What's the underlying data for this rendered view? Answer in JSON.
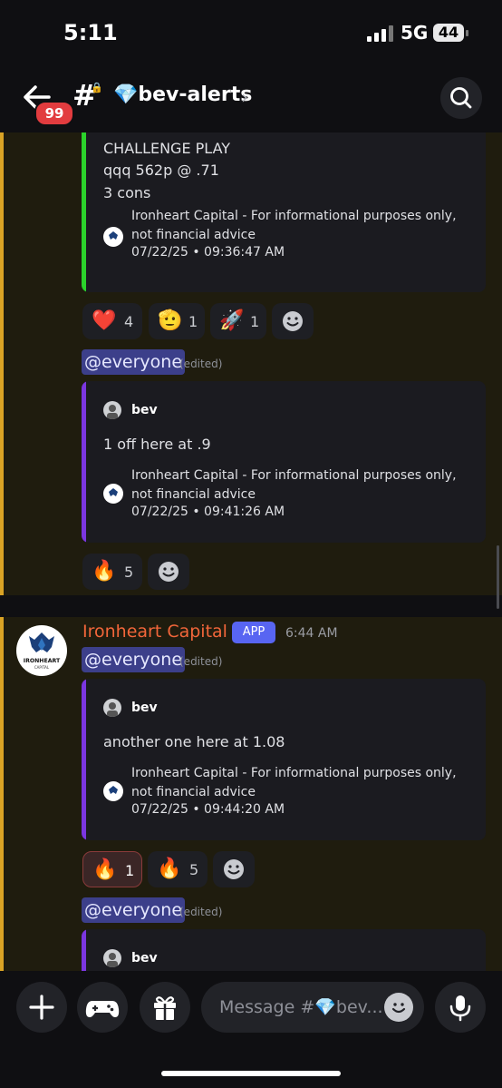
{
  "status": {
    "time": "5:11",
    "network": "5G",
    "battery": "44"
  },
  "header": {
    "unread_badge": "99",
    "hash_symbol": "#",
    "channel_name": "💎bev-alerts",
    "chevron": "›"
  },
  "messages": [
    {
      "embed": {
        "lines": [
          "CHALLENGE PLAY",
          "qqq 562p @ .71",
          "3 cons"
        ],
        "footer_text": "Ironheart Capital - For informational purposes only, not financial advice",
        "footer_date": "07/22/25  •  09:36:47 AM",
        "accent": "#2bd32b"
      },
      "reactions": [
        {
          "emoji": "❤️",
          "count": "4"
        },
        {
          "emoji": "🫡",
          "count": "1"
        },
        {
          "emoji": "🚀",
          "count": "1"
        }
      ]
    },
    {
      "mention": "@everyone",
      "edited": "(edited)",
      "embed": {
        "author": "bev",
        "text": "1 off here at .9",
        "footer_text": "Ironheart Capital - For informational purposes only, not financial advice",
        "footer_date": "07/22/25  •  09:41:26 AM",
        "accent": "#7b36e0"
      },
      "reactions": [
        {
          "emoji": "🔥",
          "count": "5"
        }
      ]
    },
    {
      "username": "Ironheart Capital",
      "app_badge": "APP",
      "time": "6:44 AM",
      "avatar_text": "IRONHEART",
      "avatar_sub": "CAPITAL",
      "mention": "@everyone",
      "edited": "(edited)",
      "embed": {
        "author": "bev",
        "text": "another one here at 1.08",
        "footer_text": "Ironheart Capital - For informational purposes only, not financial advice",
        "footer_date": "07/22/25  •  09:44:20 AM",
        "accent": "#7b36e0"
      },
      "reactions": [
        {
          "emoji": "🔥",
          "count": "1"
        },
        {
          "emoji": "🔥",
          "count": "5"
        }
      ]
    },
    {
      "mention": "@everyone",
      "edited": "(edited)",
      "embed": {
        "author": "bev",
        "accent": "#7b36e0"
      }
    }
  ],
  "composer": {
    "placeholder": "Message #💎bev..."
  }
}
